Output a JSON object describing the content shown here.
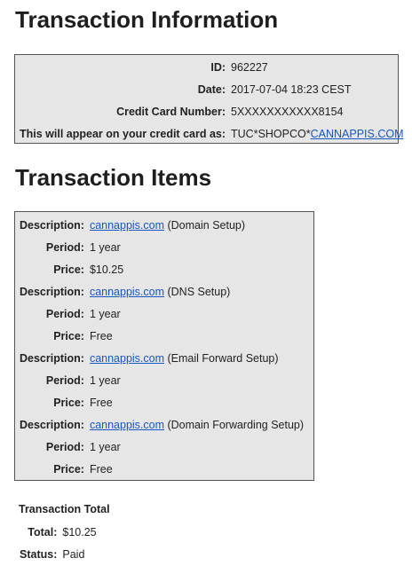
{
  "transaction_info": {
    "heading": "Transaction Information",
    "id_label": "ID:",
    "id_value": "962227",
    "date_label": "Date:",
    "date_value": "2017-07-04 18:23 CEST",
    "card_label": "Credit Card Number:",
    "card_value": "5XXXXXXXXXXX8154",
    "appear_label": "This will appear on your credit card as:",
    "appear_prefix": "TUC*SHOPCO*",
    "appear_link": "CANNAPPIS.COM"
  },
  "transaction_items": {
    "heading": "Transaction Items",
    "description_label": "Description:",
    "period_label": "Period:",
    "price_label": "Price:",
    "items": [
      {
        "domain": "cannappis.com",
        "service": " (Domain Setup)",
        "period": "1 year",
        "price": "$10.25"
      },
      {
        "domain": "cannappis.com",
        "service": " (DNS Setup)",
        "period": "1 year",
        "price": "Free"
      },
      {
        "domain": "cannappis.com",
        "service": " (Email Forward Setup)",
        "period": "1 year",
        "price": "Free"
      },
      {
        "domain": "cannappis.com",
        "service": " (Domain Forwarding Setup)",
        "period": "1 year",
        "price": "Free"
      }
    ]
  },
  "transaction_total": {
    "heading": "Transaction Total",
    "total_label": "Total:",
    "total_value": "$10.25",
    "status_label": "Status:",
    "status_value": "Paid"
  },
  "colors": {
    "box_background": "#e6e6e6",
    "link": "#1a56c4"
  }
}
